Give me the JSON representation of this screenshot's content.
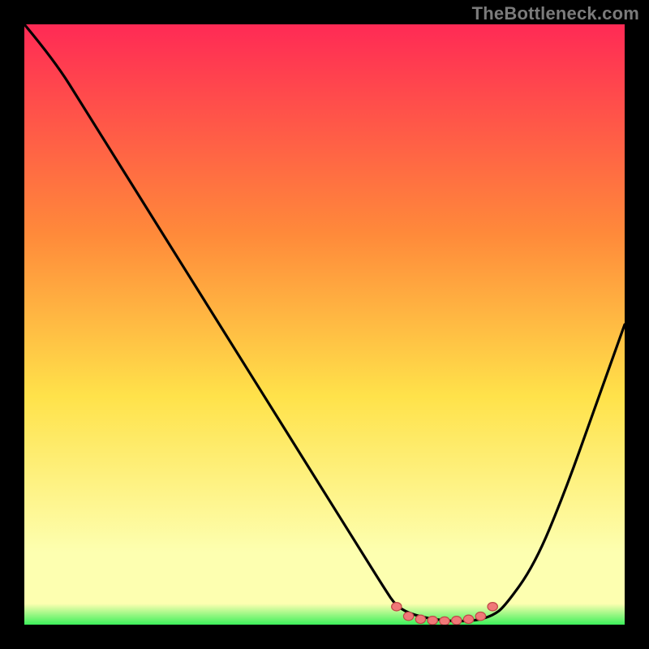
{
  "watermark": "TheBottleneck.com",
  "colors": {
    "frame": "#000000",
    "curve": "#000000",
    "marker_fill": "#f07878",
    "marker_stroke": "#c04848",
    "grad_top": "#ff2a55",
    "grad_mid1": "#ff8a3a",
    "grad_mid2": "#ffe24a",
    "grad_mid3": "#fdffb0",
    "grad_bot": "#3cf05a"
  },
  "chart_data": {
    "type": "line",
    "title": "",
    "xlabel": "",
    "ylabel": "",
    "xlim": [
      0,
      100
    ],
    "ylim": [
      0,
      100
    ],
    "grid": false,
    "legend": false,
    "series": [
      {
        "name": "bottleneck-curve",
        "x": [
          0,
          5,
          10,
          15,
          20,
          25,
          30,
          35,
          40,
          45,
          50,
          55,
          60,
          62,
          65,
          70,
          75,
          78,
          80,
          85,
          90,
          95,
          100
        ],
        "values": [
          100,
          94,
          86,
          78,
          70,
          62,
          54,
          46,
          38,
          30,
          22,
          14,
          6,
          3,
          1.5,
          0.6,
          0.6,
          1.5,
          3,
          10,
          22,
          36,
          50
        ]
      }
    ],
    "markers": {
      "name": "valley-cluster",
      "x": [
        62,
        64,
        66,
        68,
        70,
        72,
        74,
        76,
        78
      ],
      "values": [
        3.0,
        1.4,
        0.9,
        0.7,
        0.6,
        0.7,
        0.9,
        1.4,
        3.0
      ]
    }
  }
}
